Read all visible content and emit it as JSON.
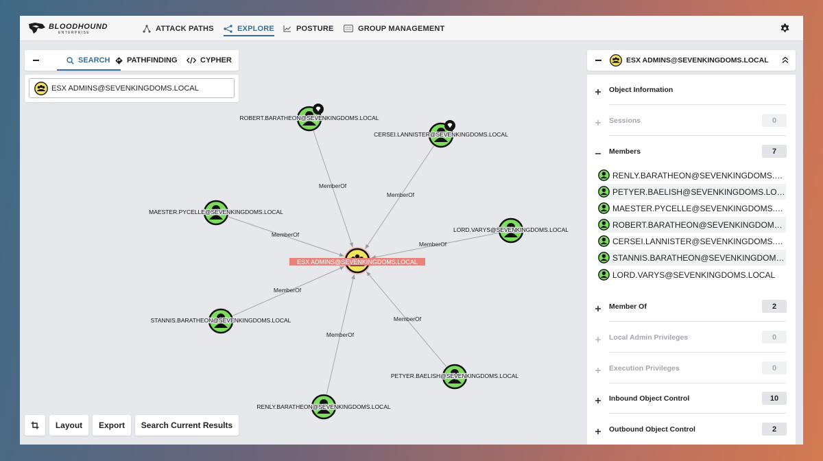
{
  "brand": {
    "name": "BLOODHOUND",
    "sub": "ENTERPRISE"
  },
  "nav": {
    "items": [
      {
        "label": "ATTACK PATHS",
        "icon": "attack-paths-icon"
      },
      {
        "label": "EXPLORE",
        "icon": "explore-icon",
        "active": true
      },
      {
        "label": "POSTURE",
        "icon": "posture-icon"
      },
      {
        "label": "GROUP MANAGEMENT",
        "icon": "group-management-icon"
      }
    ]
  },
  "left_panel": {
    "tabs": [
      {
        "label": "SEARCH",
        "active": true
      },
      {
        "label": "PATHFINDING"
      },
      {
        "label": "CYPHER"
      }
    ],
    "search_value": "ESX ADMINS@SEVENKINGDOMS.LOCAL"
  },
  "graph": {
    "center": {
      "label": "ESX ADMINS@SEVENKINGDOMS.LOCAL",
      "type": "group"
    },
    "nodes": [
      {
        "label": "ROBERT.BARATHEON@SEVENKINGDOMS.LOCAL",
        "tagged": true
      },
      {
        "label": "CERSEI.LANNISTER@SEVENKINGDOMS.LOCAL",
        "tagged": true
      },
      {
        "label": "MAESTER.PYCELLE@SEVENKINGDOMS.LOCAL"
      },
      {
        "label": "LORD.VARYS@SEVENKINGDOMS.LOCAL"
      },
      {
        "label": "STANNIS.BARATHEON@SEVENKINGDOMS.LOCAL"
      },
      {
        "label": "PETYER.BAELISH@SEVENKINGDOMS.LOCAL"
      },
      {
        "label": "RENLY.BARATHEON@SEVENKINGDOMS.LOCAL"
      }
    ],
    "edge_label": "MemberOf"
  },
  "bottom_buttons": {
    "crop": "crop-icon",
    "layout": "Layout",
    "export": "Export",
    "search_results": "Search Current Results"
  },
  "right_panel": {
    "title": "ESX ADMINS@SEVENKINGDOMS.LOCAL",
    "sections": {
      "object_information": {
        "label": "Object Information"
      },
      "sessions": {
        "label": "Sessions",
        "count": "0"
      },
      "members": {
        "label": "Members",
        "count": "7"
      },
      "member_of": {
        "label": "Member Of",
        "count": "2"
      },
      "local_admin": {
        "label": "Local Admin Privileges",
        "count": "0"
      },
      "execution": {
        "label": "Execution Privileges",
        "count": "0"
      },
      "inbound": {
        "label": "Inbound Object Control",
        "count": "10"
      },
      "outbound": {
        "label": "Outbound Object Control",
        "count": "2"
      }
    },
    "members": [
      "RENLY.BARATHEON@SEVENKINGDOMS.LOCAL",
      "PETYER.BAELISH@SEVENKINGDOMS.LOCAL",
      "MAESTER.PYCELLE@SEVENKINGDOMS.LOCAL",
      "ROBERT.BARATHEON@SEVENKINGDOMS.LOCAL",
      "CERSEI.LANNISTER@SEVENKINGDOMS.LOCAL",
      "STANNIS.BARATHEON@SEVENKINGDOMS.LOCAL",
      "LORD.VARYS@SEVENKINGDOMS.LOCAL"
    ]
  },
  "colors": {
    "accent": "#3a6d9a",
    "user_node": "#7ddb5e",
    "group_node": "#f2e35c",
    "highlight_label": "#e8827a"
  }
}
